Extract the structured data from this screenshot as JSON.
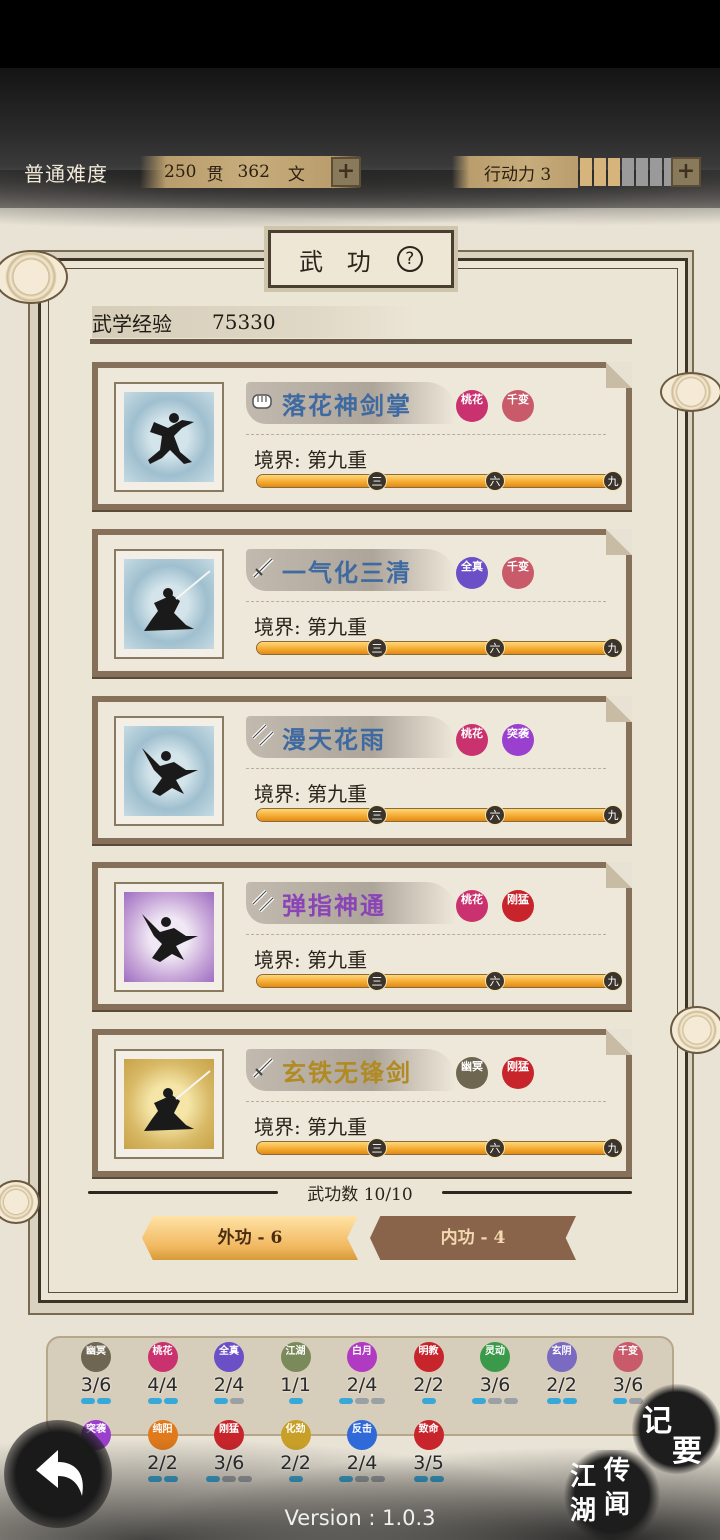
{
  "header": {
    "difficulty": "普通难度",
    "money": {
      "guan_value": "250",
      "guan_unit": "贯",
      "wen_value": "362",
      "wen_unit": "文"
    },
    "action_power_label": "行动力 3",
    "action_power_filled": 3,
    "action_power_total": 7
  },
  "panel": {
    "title": "武 功",
    "exp_label": "武学经验",
    "exp_value": "75330",
    "count_label": "武功数 10/10"
  },
  "skills": [
    {
      "name": "落花神剑掌",
      "type": "fist",
      "realm": "境界: 第九重",
      "progress": 1.0,
      "color": "#3f6aa1",
      "tags": [
        {
          "text": "桃花",
          "color": "#c9326e"
        },
        {
          "text": "千变",
          "color": "#c85a6a"
        }
      ]
    },
    {
      "name": "一气化三清",
      "type": "sword",
      "realm": "境界: 第九重",
      "progress": 1.0,
      "color": "#3f6aa1",
      "tags": [
        {
          "text": "全真",
          "color": "#6b4fc6"
        },
        {
          "text": "千变",
          "color": "#c85a6a"
        }
      ]
    },
    {
      "name": "漫天花雨",
      "type": "dart",
      "realm": "境界: 第九重",
      "progress": 1.0,
      "color": "#3f6aa1",
      "tags": [
        {
          "text": "桃花",
          "color": "#c9326e"
        },
        {
          "text": "突袭",
          "color": "#9b3fcf"
        }
      ]
    },
    {
      "name": "弹指神通",
      "type": "dart",
      "realm": "境界: 第九重",
      "progress": 1.0,
      "color": "#8a44b8",
      "tags": [
        {
          "text": "桃花",
          "color": "#c9326e"
        },
        {
          "text": "刚猛",
          "color": "#c8242c"
        }
      ]
    },
    {
      "name": "玄铁无锋剑",
      "type": "sword",
      "realm": "境界: 第九重",
      "progress": 1.0,
      "color": "#b18a22",
      "tags": [
        {
          "text": "幽冥",
          "color": "#6e6650"
        },
        {
          "text": "刚猛",
          "color": "#c8242c"
        }
      ]
    }
  ],
  "progress_markers": [
    "三",
    "六",
    "九"
  ],
  "tabs": [
    {
      "label": "外功 - 6",
      "active": true
    },
    {
      "label": "内功 - 4",
      "active": false
    }
  ],
  "sects": [
    {
      "name": "幽冥",
      "value": "3/6",
      "color": "#6e6650",
      "pips": 2,
      "total": 2
    },
    {
      "name": "桃花",
      "value": "4/4",
      "color": "#c9326e",
      "pips": 2,
      "total": 2
    },
    {
      "name": "全真",
      "value": "2/4",
      "color": "#6b4fc6",
      "pips": 1,
      "total": 2
    },
    {
      "name": "江湖",
      "value": "1/1",
      "color": "#7a8a5a",
      "pips": 1,
      "total": 1
    },
    {
      "name": "白月",
      "value": "2/4",
      "color": "#b03ac2",
      "pips": 1,
      "total": 3
    },
    {
      "name": "明教",
      "value": "2/2",
      "color": "#c8242c",
      "pips": 1,
      "total": 1
    },
    {
      "name": "灵动",
      "value": "3/6",
      "color": "#3a9a4a",
      "pips": 1,
      "total": 3
    },
    {
      "name": "玄阴",
      "value": "2/2",
      "color": "#7a6ac2",
      "pips": 2,
      "total": 2
    },
    {
      "name": "千变",
      "value": "3/6",
      "color": "#c85a6a",
      "pips": 1,
      "total": 2
    },
    {
      "name": "突袭",
      "value": "",
      "color": "#9b3fcf",
      "pips": 0,
      "total": 0
    },
    {
      "name": "纯阳",
      "value": "2/2",
      "color": "#e07a1c",
      "pips": 2,
      "total": 2
    },
    {
      "name": "刚猛",
      "value": "3/6",
      "color": "#c8242c",
      "pips": 1,
      "total": 3
    },
    {
      "name": "化劲",
      "value": "2/2",
      "color": "#c8a028",
      "pips": 1,
      "total": 1
    },
    {
      "name": "反击",
      "value": "2/4",
      "color": "#2f6ad8",
      "pips": 1,
      "total": 3
    },
    {
      "name": "致命",
      "value": "3/5",
      "color": "#c8242c",
      "pips": 2,
      "total": 2
    }
  ],
  "buttons": {
    "memo": [
      "记",
      "要"
    ],
    "rumor": [
      "江",
      "湖",
      "传",
      "闻"
    ]
  },
  "version": "Version : 1.0.3"
}
